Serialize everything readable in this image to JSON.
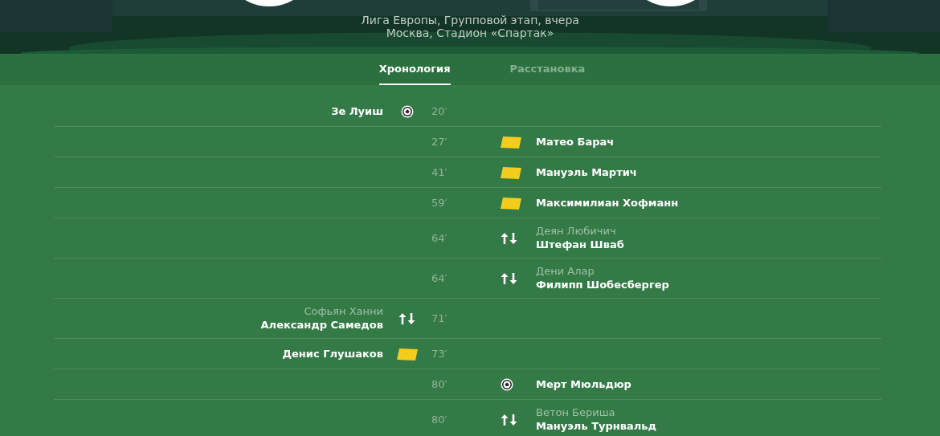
{
  "match": {
    "competition": "Лига Европы, Групповой этап, вчера",
    "venue": "Москва, Стадион «Спартак»"
  },
  "tabs": [
    {
      "label": "Хронология",
      "selected": true
    },
    {
      "label": "Расстановка",
      "selected": false
    }
  ],
  "events": [
    {
      "minute": "20′",
      "away": false,
      "kind": "goal",
      "player": "Зе Луиш"
    },
    {
      "minute": "27′",
      "away": true,
      "kind": "yellow",
      "player": "Матео Барач"
    },
    {
      "minute": "41′",
      "away": true,
      "kind": "yellow",
      "player": "Мануэль Мартич"
    },
    {
      "minute": "59′",
      "away": true,
      "kind": "yellow",
      "player": "Максимилиан Хофманн"
    },
    {
      "minute": "64′",
      "away": true,
      "kind": "sub",
      "secondary": "Деян Любичич",
      "player": "Штефан Шваб"
    },
    {
      "minute": "64′",
      "away": true,
      "kind": "sub",
      "secondary": "Дени Алар",
      "player": "Филипп Шобесбергер"
    },
    {
      "minute": "71′",
      "away": false,
      "kind": "sub",
      "secondary": "Софьян Ханни",
      "player": "Александр Самедов"
    },
    {
      "minute": "73′",
      "away": false,
      "kind": "yellow",
      "player": "Денис Глушаков"
    },
    {
      "minute": "80′",
      "away": true,
      "kind": "goal",
      "player": "Мерт Мюльдюр"
    },
    {
      "minute": "80′",
      "away": true,
      "kind": "sub",
      "secondary": "Ветон Бериша",
      "player": "Мануэль Турнвальд"
    }
  ]
}
